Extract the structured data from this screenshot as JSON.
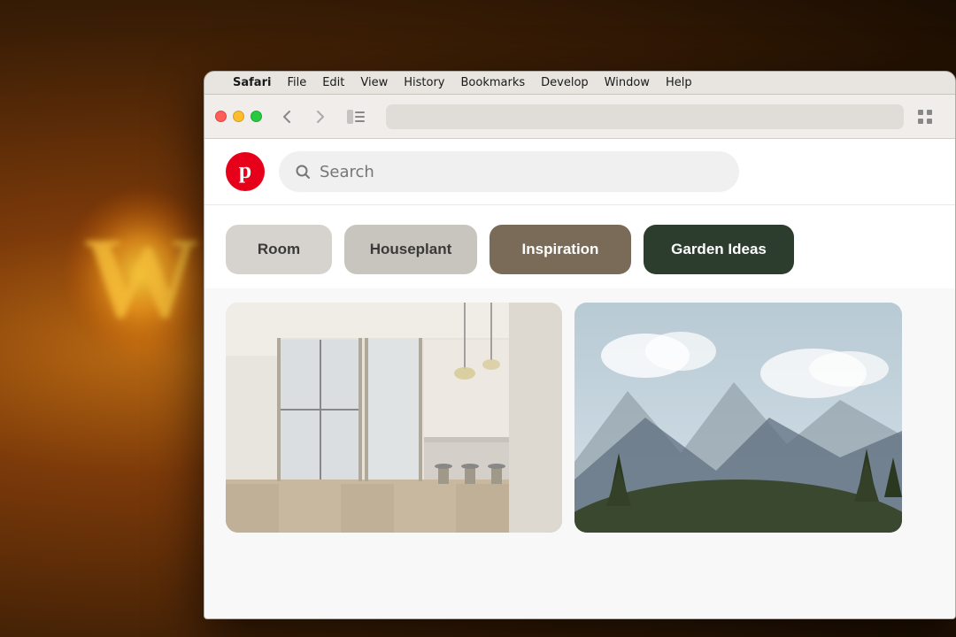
{
  "background": {
    "color": "#2a1a0a"
  },
  "menubar": {
    "apple_symbol": "",
    "items": [
      {
        "label": "Safari",
        "bold": true
      },
      {
        "label": "File"
      },
      {
        "label": "Edit"
      },
      {
        "label": "View"
      },
      {
        "label": "History"
      },
      {
        "label": "Bookmarks"
      },
      {
        "label": "Develop"
      },
      {
        "label": "Window"
      },
      {
        "label": "Help"
      }
    ]
  },
  "browser": {
    "traffic_lights": {
      "red_title": "Close",
      "yellow_title": "Minimize",
      "green_title": "Maximize"
    },
    "back_arrow": "‹",
    "forward_arrow": "›",
    "address_placeholder": ""
  },
  "pinterest": {
    "logo_letter": "p",
    "search": {
      "placeholder": "Search",
      "icon": "🔍"
    },
    "categories": [
      {
        "label": "Room",
        "style": "light-gray"
      },
      {
        "label": "Houseplant",
        "style": "gray"
      },
      {
        "label": "Inspiration",
        "style": "dark-tan"
      },
      {
        "label": "Garden Ideas",
        "style": "dark-green"
      }
    ]
  }
}
